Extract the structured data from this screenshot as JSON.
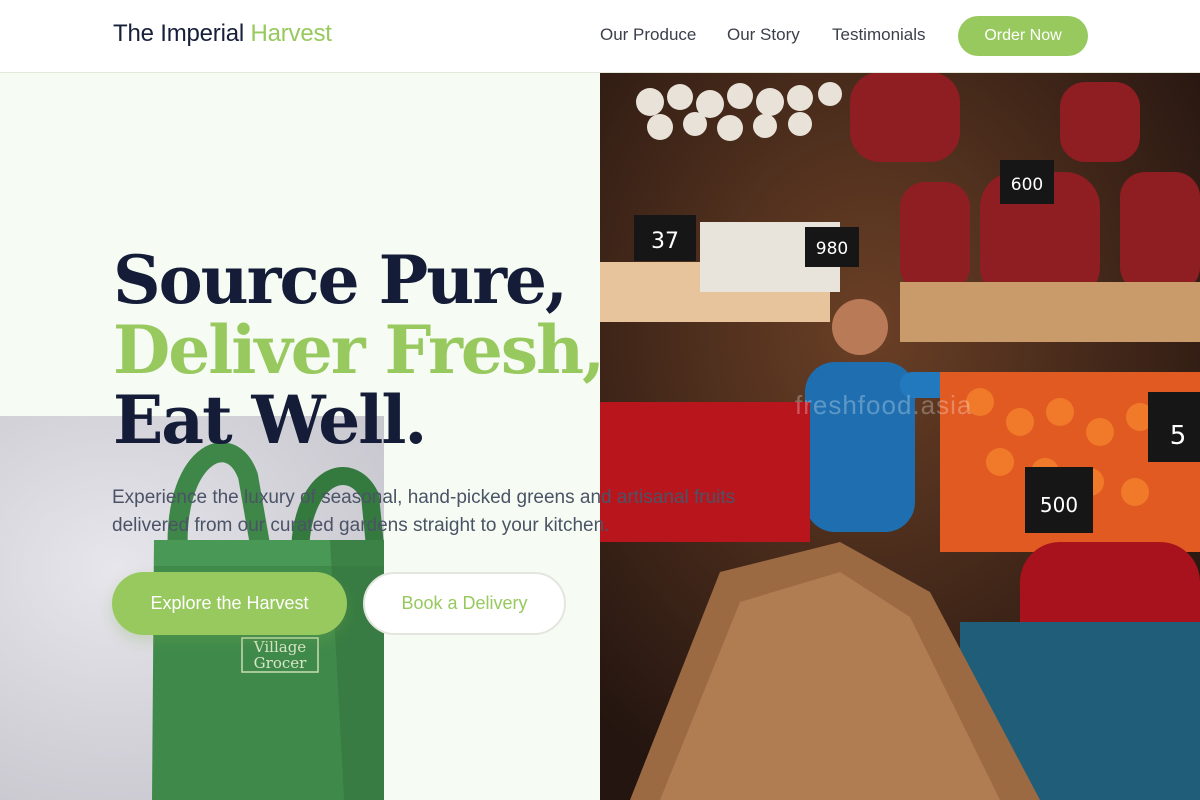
{
  "header": {
    "brand_main": "The Imperial",
    "brand_accent": "Harvest",
    "nav": [
      "Our Produce",
      "Our Story",
      "Testimonials"
    ],
    "cta": "Order Now"
  },
  "hero": {
    "title_line1": "Source Pure,",
    "title_line2": "Deliver Fresh,",
    "title_line3": "Eat Well.",
    "subtitle": "Experience the luxury of seasonal, hand-picked greens and artisanal fruits delivered from our curated gardens straight to your kitchen.",
    "primary_button": "Explore the Harvest",
    "secondary_button": "Book a Delivery"
  },
  "images": {
    "bag_print": [
      "Village",
      "Grocer"
    ],
    "market_watermark": "freshfood.asia",
    "price_tags": [
      "600",
      "980",
      "37",
      "500",
      "5"
    ]
  },
  "colors": {
    "accent": "#97c95f",
    "heading": "#141c38",
    "body_text": "#4b5366",
    "background": "#f6fcf3"
  }
}
